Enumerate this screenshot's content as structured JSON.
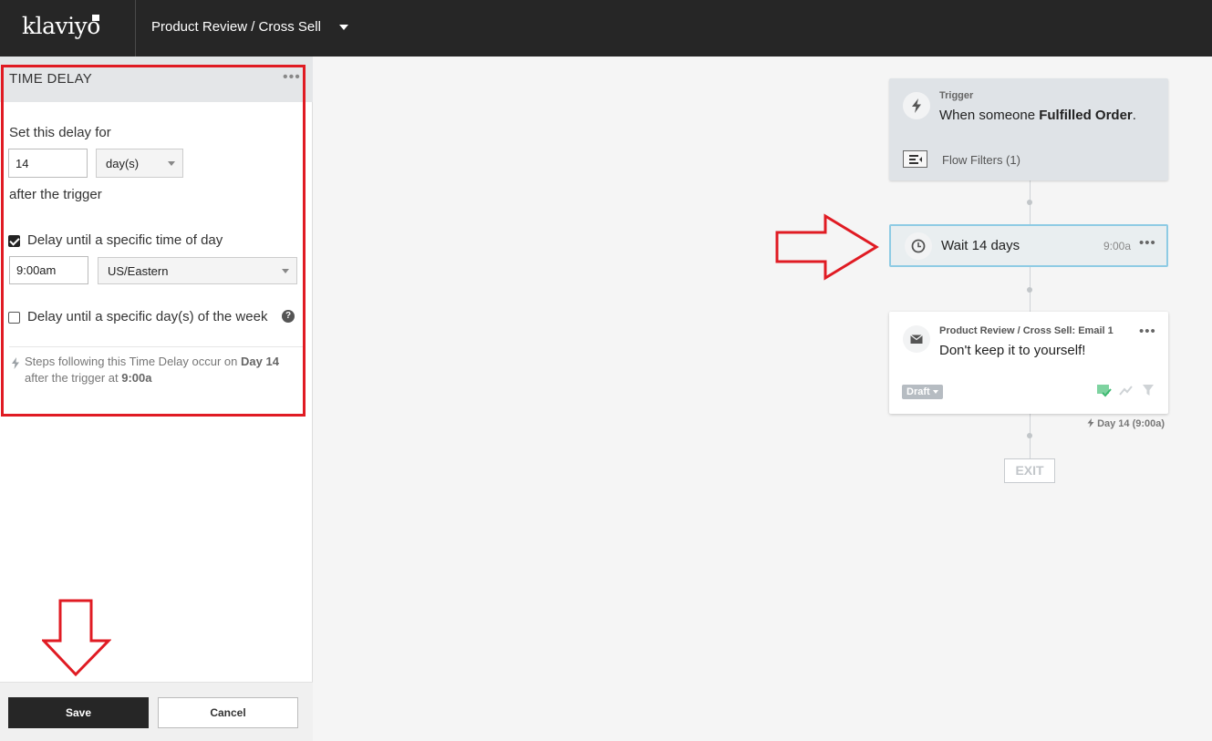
{
  "header": {
    "logo": "klaviyo",
    "flow_title": "Product Review / Cross Sell"
  },
  "panel": {
    "title": "TIME DELAY",
    "set_delay_label": "Set this delay for",
    "delay_value": "14",
    "delay_unit": "day(s)",
    "after_trigger_label": "after the trigger",
    "time_of_day_checked": true,
    "time_of_day_label": "Delay until a specific time of day",
    "time_value": "9:00am",
    "timezone": "US/Eastern",
    "day_of_week_checked": false,
    "day_of_week_label": "Delay until a specific day(s) of the week",
    "note": {
      "prefix": "Steps following this Time Delay occur on ",
      "day": "Day 14",
      "middle": " after the trigger at ",
      "time": "9:00a"
    },
    "save_label": "Save",
    "cancel_label": "Cancel"
  },
  "canvas": {
    "trigger": {
      "label": "Trigger",
      "desc_prefix": "When someone ",
      "desc_event": "Fulfilled Order",
      "desc_suffix": ".",
      "filters_label": "Flow Filters (1)"
    },
    "wait": {
      "label": "Wait 14 days",
      "time": "9:00a"
    },
    "email": {
      "title": "Product Review / Cross Sell: Email 1",
      "subject": "Don't keep it to yourself!",
      "status": "Draft"
    },
    "day_label": "Day 14 (9:00a)",
    "exit_label": "EXIT"
  },
  "icons": {
    "trigger": "bolt-icon",
    "wait": "clock-icon",
    "email": "envelope-icon",
    "filters": "filter-list-icon",
    "help": "question-circle-icon"
  },
  "colors": {
    "annotation_red": "#e01b23",
    "topbar": "#262626",
    "wait_border": "#8ecbe4",
    "check_green": "#3bb86f"
  }
}
